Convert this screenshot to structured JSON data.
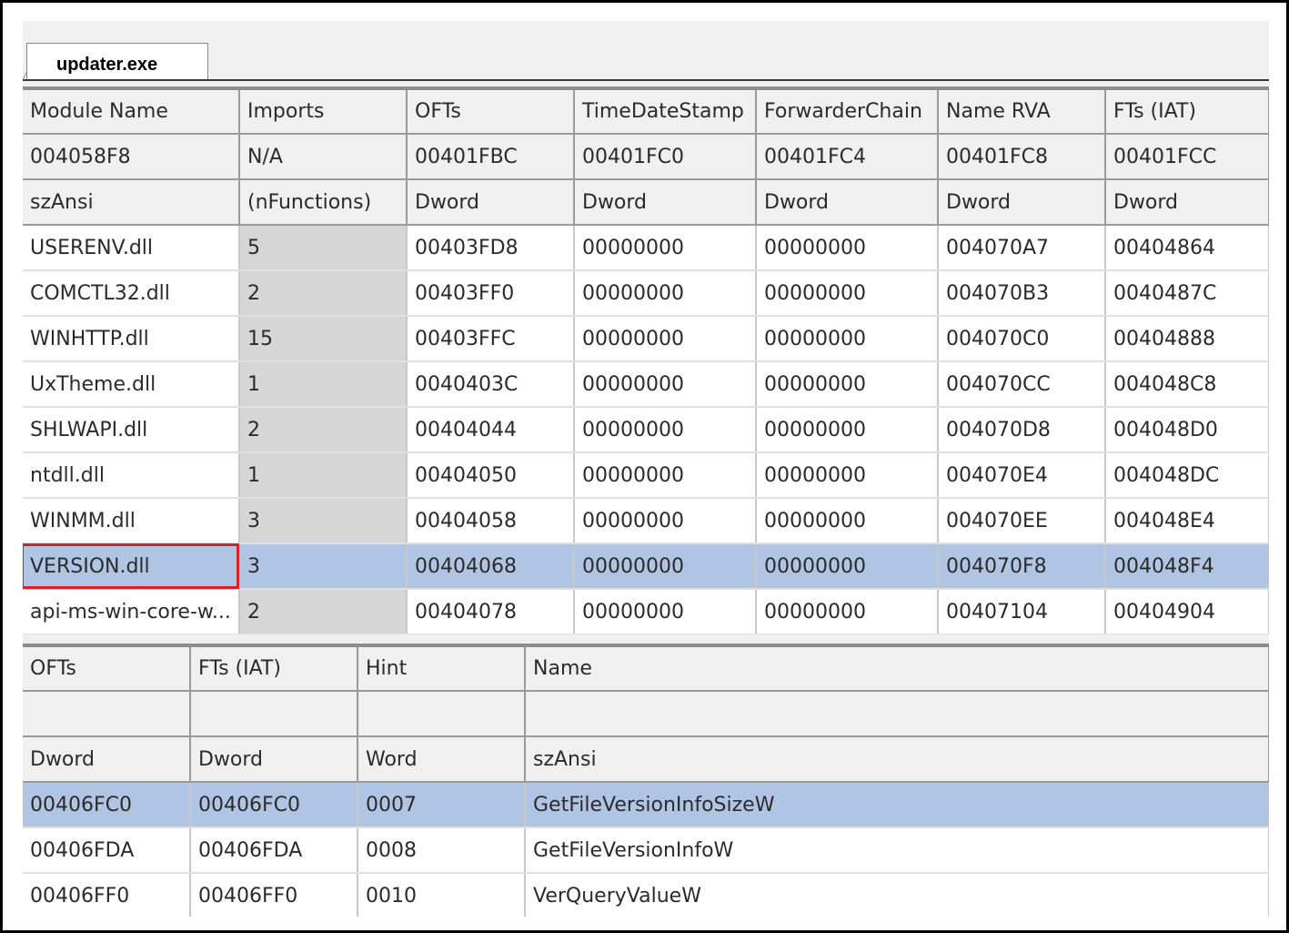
{
  "tab": {
    "label": "updater.exe"
  },
  "upper_table": {
    "header_rows": [
      [
        "Module Name",
        "Imports",
        "OFTs",
        "TimeDateStamp",
        "ForwarderChain",
        "Name RVA",
        "FTs (IAT)"
      ],
      [
        "004058F8",
        "N/A",
        "00401FBC",
        "00401FC0",
        "00401FC4",
        "00401FC8",
        "00401FCC"
      ],
      [
        "szAnsi",
        "(nFunctions)",
        "Dword",
        "Dword",
        "Dword",
        "Dword",
        "Dword"
      ]
    ],
    "rows": [
      [
        "USERENV.dll",
        "5",
        "00403FD8",
        "00000000",
        "00000000",
        "004070A7",
        "00404864"
      ],
      [
        "COMCTL32.dll",
        "2",
        "00403FF0",
        "00000000",
        "00000000",
        "004070B3",
        "0040487C"
      ],
      [
        "WINHTTP.dll",
        "15",
        "00403FFC",
        "00000000",
        "00000000",
        "004070C0",
        "00404888"
      ],
      [
        "UxTheme.dll",
        "1",
        "0040403C",
        "00000000",
        "00000000",
        "004070CC",
        "004048C8"
      ],
      [
        "SHLWAPI.dll",
        "2",
        "00404044",
        "00000000",
        "00000000",
        "004070D8",
        "004048D0"
      ],
      [
        "ntdll.dll",
        "1",
        "00404050",
        "00000000",
        "00000000",
        "004070E4",
        "004048DC"
      ],
      [
        "WINMM.dll",
        "3",
        "00404058",
        "00000000",
        "00000000",
        "004070EE",
        "004048E4"
      ],
      [
        "VERSION.dll",
        "3",
        "00404068",
        "00000000",
        "00000000",
        "004070F8",
        "004048F4"
      ],
      [
        "api-ms-win-core-w...",
        "2",
        "00404078",
        "00000000",
        "00000000",
        "00407104",
        "00404904"
      ]
    ],
    "selected_row": 7
  },
  "lower_table": {
    "header_rows": [
      [
        "OFTs",
        "FTs (IAT)",
        "Hint",
        "Name"
      ],
      [
        "",
        "",
        "",
        ""
      ],
      [
        "Dword",
        "Dword",
        "Word",
        "szAnsi"
      ]
    ],
    "rows": [
      [
        "00406FC0",
        "00406FC0",
        "0007",
        "GetFileVersionInfoSizeW"
      ],
      [
        "00406FDA",
        "00406FDA",
        "0008",
        "GetFileVersionInfoW"
      ],
      [
        "00406FF0",
        "00406FF0",
        "0010",
        "VerQueryValueW"
      ]
    ],
    "selected_row": 0
  },
  "colors": {
    "selection": "#b0c4e4",
    "highlight_box": "#e02020",
    "imports_column": "#d6d6d6"
  }
}
